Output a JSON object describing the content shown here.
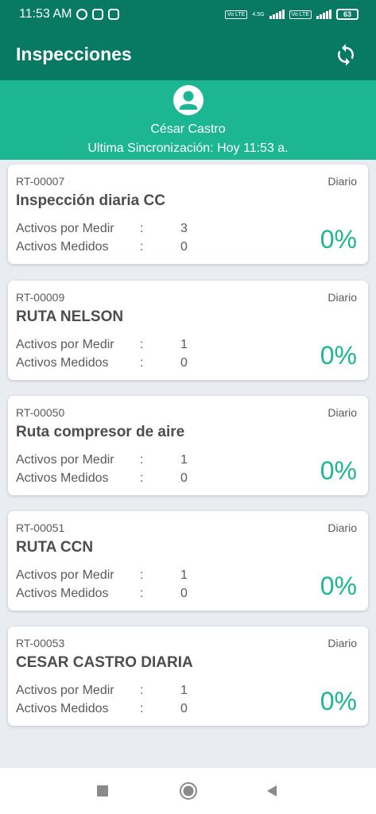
{
  "status_bar": {
    "time": "11:53 AM",
    "volte_label": "Vo LTE",
    "network_label": "4.5G",
    "battery": "63"
  },
  "app_bar": {
    "title": "Inspecciones"
  },
  "profile": {
    "name": "César Castro",
    "last_sync": "Ultima Sincronización: Hoy 11:53 a."
  },
  "colors": {
    "primary_dark": "#087a63",
    "accent": "#1db692",
    "background": "#e9edf2"
  },
  "routes": [
    {
      "code": "RT-00007",
      "frequency": "Diario",
      "name": "Inspección diaria CC",
      "to_measure_label": "Activos por Medir",
      "to_measure": "3",
      "measured_label": "Activos Medidos",
      "measured": "0",
      "separator": ":",
      "progress": "0%"
    },
    {
      "code": "RT-00009",
      "frequency": "Diario",
      "name": "RUTA NELSON",
      "to_measure_label": "Activos por Medir",
      "to_measure": "1",
      "measured_label": "Activos Medidos",
      "measured": "0",
      "separator": ":",
      "progress": "0%"
    },
    {
      "code": "RT-00050",
      "frequency": "Diario",
      "name": "Ruta compresor de aire",
      "to_measure_label": "Activos por Medir",
      "to_measure": "1",
      "measured_label": "Activos Medidos",
      "measured": "0",
      "separator": ":",
      "progress": "0%"
    },
    {
      "code": "RT-00051",
      "frequency": "Diario",
      "name": "RUTA CCN",
      "to_measure_label": "Activos por Medir",
      "to_measure": "1",
      "measured_label": "Activos Medidos",
      "measured": "0",
      "separator": ":",
      "progress": "0%"
    },
    {
      "code": "RT-00053",
      "frequency": "Diario",
      "name": "CESAR CASTRO DIARIA",
      "to_measure_label": "Activos por Medir",
      "to_measure": "1",
      "measured_label": "Activos Medidos",
      "measured": "0",
      "separator": ":",
      "progress": "0%"
    }
  ],
  "nav": {
    "recents_icon": "square-icon",
    "home_icon": "circle-icon",
    "back_icon": "triangle-icon"
  }
}
